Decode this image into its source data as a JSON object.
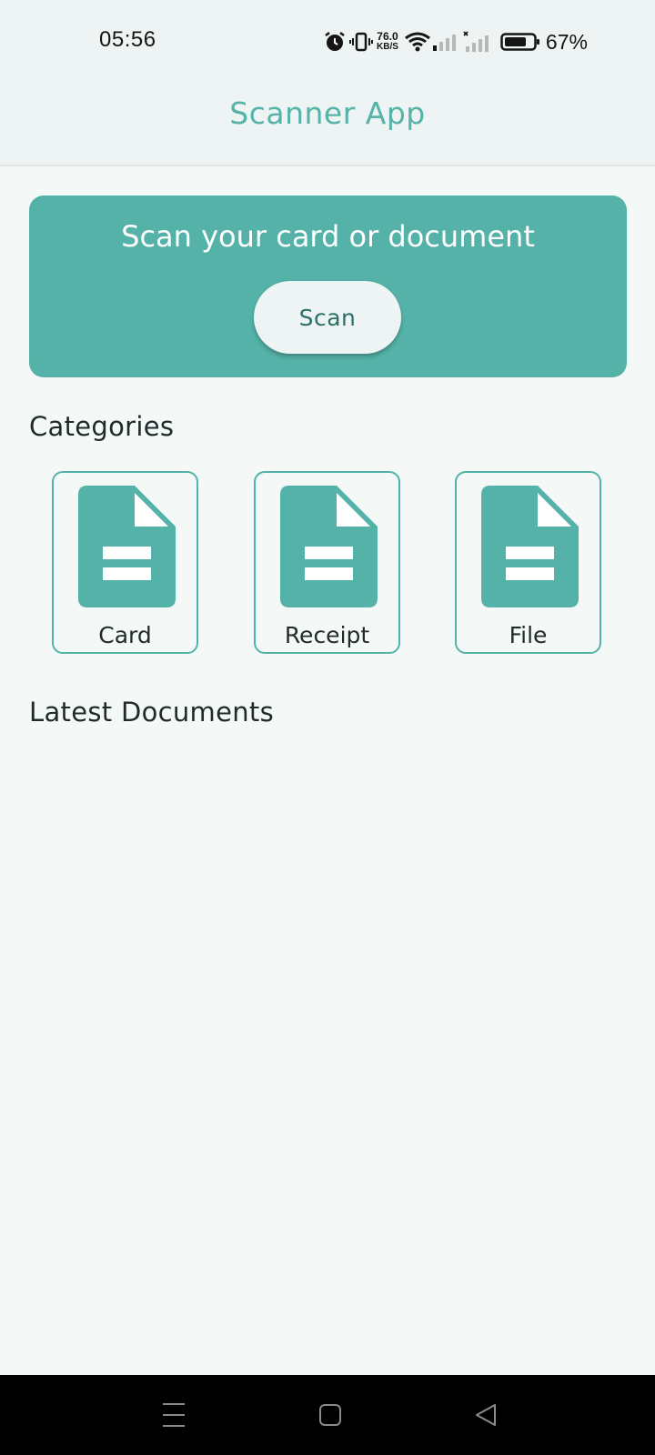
{
  "status_bar": {
    "time": "05:56",
    "net_speed_value": "76.0",
    "net_speed_unit": "KB/S",
    "battery": "67%",
    "icons": [
      "alarm-icon",
      "vibrate-icon",
      "wifi-icon",
      "signal-icon",
      "signal-no-service-icon",
      "battery-icon"
    ]
  },
  "app_bar": {
    "title": "Scanner App"
  },
  "scan_banner": {
    "heading": "Scan your card or document",
    "button_label": "Scan"
  },
  "categories": {
    "title": "Categories",
    "items": [
      {
        "label": "Card",
        "icon": "document-icon"
      },
      {
        "label": "Receipt",
        "icon": "document-icon"
      },
      {
        "label": "File",
        "icon": "document-icon"
      }
    ]
  },
  "latest": {
    "title": "Latest Documents"
  },
  "nav_bar": {
    "buttons": [
      "menu-icon",
      "home-icon",
      "back-icon"
    ]
  },
  "colors": {
    "accent": "#54b2a8",
    "title": "#55b3a8",
    "button_text": "#2a6f68",
    "background": "#f4f9f8",
    "app_bar_bg": "#eef3f3"
  }
}
